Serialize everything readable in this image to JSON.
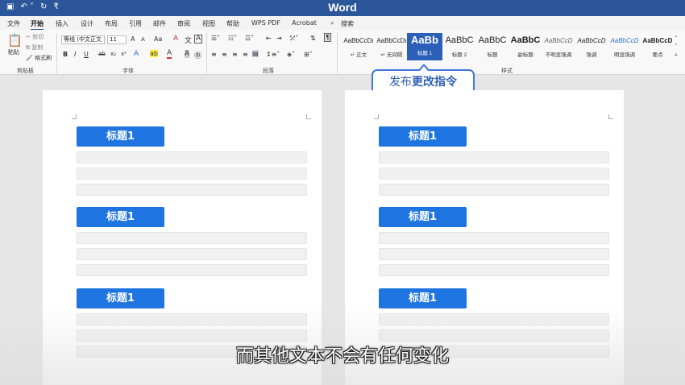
{
  "app_title": "Word",
  "quick_access": {
    "save_icon": "save-icon",
    "undo_icon": "undo-icon",
    "redo_icon": "redo-icon",
    "customize_icon": "customize-icon"
  },
  "menu": {
    "tabs": [
      "文件",
      "开始",
      "插入",
      "设计",
      "布局",
      "引用",
      "邮件",
      "审阅",
      "视图",
      "帮助",
      "WPS PDF",
      "Acrobat"
    ],
    "active_tab": "开始",
    "search_label": "搜索"
  },
  "clipboard": {
    "paste": "粘贴",
    "cut": "剪切",
    "copy": "复制",
    "format_painter": "格式刷",
    "group": "剪贴板"
  },
  "font": {
    "name": "等线 (中文正文",
    "size": "11",
    "grow": "A",
    "shrink": "A",
    "case": "Aa",
    "clear": "A",
    "bold": "B",
    "italic": "I",
    "underline": "U",
    "strike": "ab",
    "subscript": "x₂",
    "superscript": "x²",
    "effects": "A",
    "highlight": "ab",
    "color": "A",
    "group": "字体"
  },
  "paragraph": {
    "group": "段落"
  },
  "styles": {
    "group": "样式",
    "items": [
      {
        "preview": "AaBbCcDı",
        "name": "↵ 正文"
      },
      {
        "preview": "AaBbCcDı",
        "name": "↵ 无间隔"
      },
      {
        "preview": "AaBb",
        "name": "标题 1"
      },
      {
        "preview": "AaBbC",
        "name": "标题 2"
      },
      {
        "preview": "AaBbC",
        "name": "标题"
      },
      {
        "preview": "AaBbC",
        "name": "副标题"
      },
      {
        "preview": "AaBbCcD",
        "name": "不明显强调"
      },
      {
        "preview": "AaBbCcD",
        "name": "强调"
      },
      {
        "preview": "AaBbCcD",
        "name": "明显强调"
      },
      {
        "preview": "AaBbCcD",
        "name": "要点"
      }
    ]
  },
  "callout": {
    "prefix": "发布",
    "emphasis": "更改指令"
  },
  "document": {
    "left_page": {
      "headings": [
        "标题1",
        "标题1",
        "标题1"
      ]
    },
    "right_page": {
      "headings": [
        "标题1",
        "标题1",
        "标题1"
      ]
    }
  },
  "subtitle": "而其他文本不会有任何变化",
  "colors": {
    "brand": "#2b579a",
    "heading_fill": "#1e74e0",
    "callout_border": "#3f76d6",
    "selected_style": "#2b5fb8"
  }
}
